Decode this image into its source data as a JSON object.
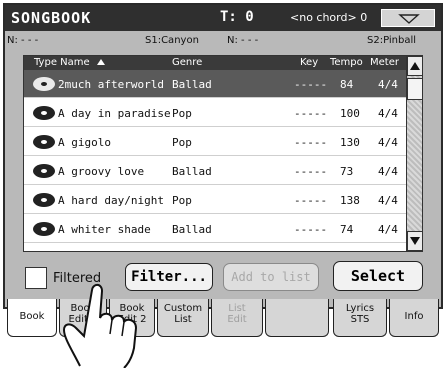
{
  "header": {
    "title": "SONGBOOK",
    "tempo_label": "T: 0",
    "chord_label": "<no chord> 0",
    "menu_icon": "chevron-down-icon"
  },
  "info_line": {
    "left_upper": "N: - - -",
    "style1": "S1:Canyon",
    "right_upper": "N: - - -",
    "style2": "S2:Pinball"
  },
  "list": {
    "columns": [
      "Type Name",
      "Genre",
      "Key",
      "Tempo",
      "Meter"
    ],
    "rows": [
      {
        "name": "2much afterworld",
        "genre": "Ballad",
        "key": "-----",
        "tempo": "84",
        "meter": "4/4",
        "selected": true
      },
      {
        "name": "A day in paradise",
        "genre": "Pop",
        "key": "-----",
        "tempo": "100",
        "meter": "4/4",
        "selected": false
      },
      {
        "name": "A gigolo",
        "genre": "Pop",
        "key": "-----",
        "tempo": "130",
        "meter": "4/4",
        "selected": false
      },
      {
        "name": "A groovy love",
        "genre": "Ballad",
        "key": "-----",
        "tempo": "73",
        "meter": "4/4",
        "selected": false
      },
      {
        "name": "A hard day/night",
        "genre": "Pop",
        "key": "-----",
        "tempo": "138",
        "meter": "4/4",
        "selected": false
      },
      {
        "name": "A whiter shade",
        "genre": "Ballad",
        "key": "-----",
        "tempo": "74",
        "meter": "4/4",
        "selected": false
      }
    ]
  },
  "controls": {
    "filtered_label": "Filtered",
    "filter_button": "Filter...",
    "add_to_list_button": "Add to list",
    "select_button": "Select"
  },
  "tabs": [
    {
      "label": "Book",
      "state": "active"
    },
    {
      "label": "Book\nEdit 1",
      "state": "normal"
    },
    {
      "label": "Book\nEdit 2",
      "state": "normal"
    },
    {
      "label": "Custom\nList",
      "state": "normal"
    },
    {
      "label": "List\nEdit",
      "state": "disabled"
    },
    {
      "label": "",
      "state": "normal"
    },
    {
      "label": "Lyrics\nSTS",
      "state": "normal"
    },
    {
      "label": "Info",
      "state": "normal"
    }
  ],
  "colors": {
    "titlebar": "#2f2f2f",
    "selected_row": "#5a5a5a",
    "panel_bg": "#b9b9b9"
  }
}
